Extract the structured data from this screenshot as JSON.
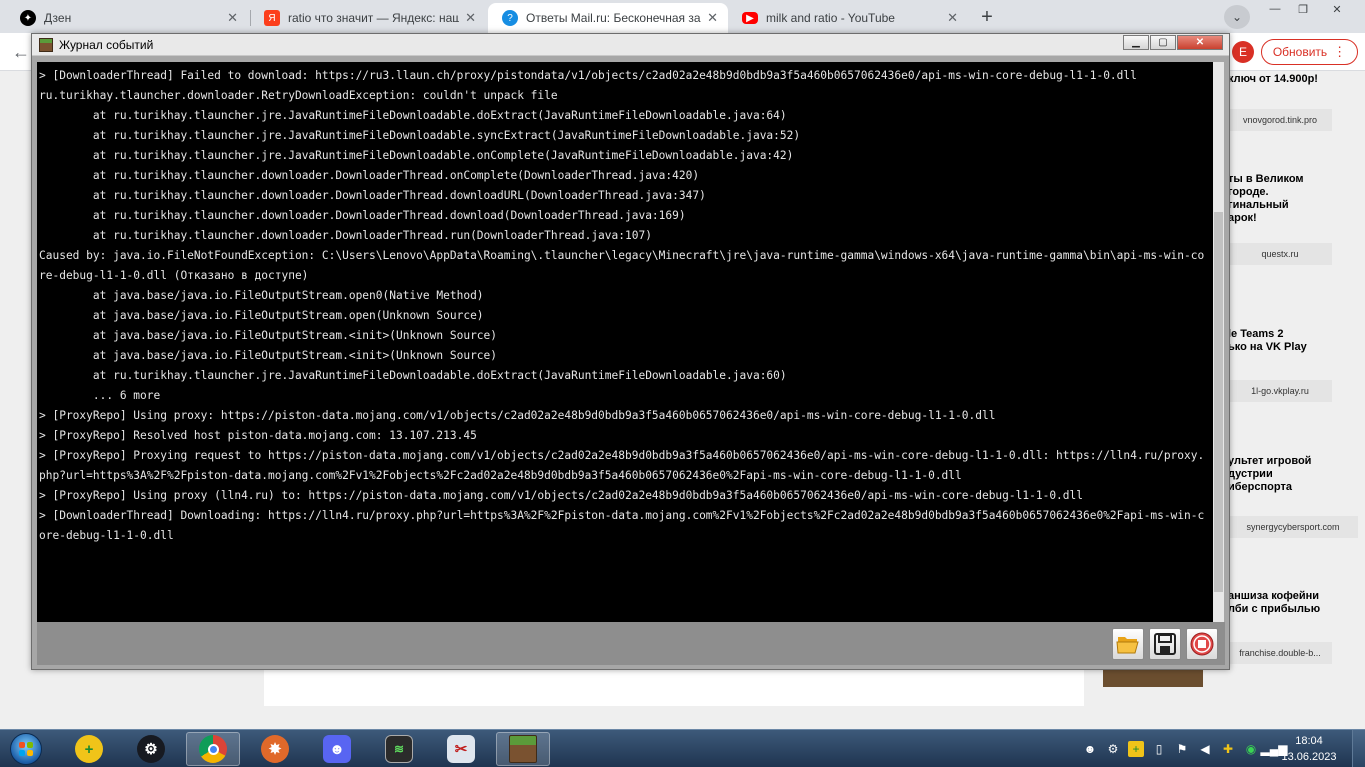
{
  "browser": {
    "tabs": [
      {
        "title": "Дзен",
        "icon": "dzen-icon",
        "color": "#000000",
        "active": false
      },
      {
        "title": "ratio что значит — Яндекс: наш",
        "icon": "yandex-icon",
        "color": "#fc3f1d",
        "active": false
      },
      {
        "title": "Ответы Mail.ru: Бесконечная за",
        "icon": "mailru-answers-icon",
        "color": "#168de2",
        "active": true
      },
      {
        "title": "milk and ratio - YouTube",
        "icon": "youtube-icon",
        "color": "#ff0000",
        "active": false
      }
    ],
    "profile_initial": "E",
    "update_label": "Обновить"
  },
  "webpage": {
    "side_ads": [
      {
        "text": "ключ от 14.900р!",
        "source": "vnovgorod.tink.pro"
      },
      {
        "text": "ты в Великом\nгороде.\nгинальный\nарок!",
        "source": "questx.ru"
      },
      {
        "text": "le Teams 2\nько на VK Play",
        "source": "1l-go.vkplay.ru"
      },
      {
        "text": "ультет игровой\nдустрии\nиберспорта",
        "source": "synergycybersport.com"
      },
      {
        "text": "аншиза кофейни\nлби с прибылью",
        "source": "franchise.double-b..."
      }
    ]
  },
  "journal": {
    "title": "Журнал событий",
    "log": [
      "> [DownloaderThread] Failed to download: https://ru3.llaun.ch/proxy/pistondata/v1/objects/c2ad02a2e48b9d0bdb9a3f5a460b0657062436e0/api-ms-win-core-debug-l1-1-0.dll",
      "ru.turikhay.tlauncher.downloader.RetryDownloadException: couldn't unpack file",
      "        at ru.turikhay.tlauncher.jre.JavaRuntimeFileDownloadable.doExtract(JavaRuntimeFileDownloadable.java:64)",
      "        at ru.turikhay.tlauncher.jre.JavaRuntimeFileDownloadable.syncExtract(JavaRuntimeFileDownloadable.java:52)",
      "        at ru.turikhay.tlauncher.jre.JavaRuntimeFileDownloadable.onComplete(JavaRuntimeFileDownloadable.java:42)",
      "        at ru.turikhay.tlauncher.downloader.DownloaderThread.onComplete(DownloaderThread.java:420)",
      "        at ru.turikhay.tlauncher.downloader.DownloaderThread.downloadURL(DownloaderThread.java:347)",
      "        at ru.turikhay.tlauncher.downloader.DownloaderThread.download(DownloaderThread.java:169)",
      "        at ru.turikhay.tlauncher.downloader.DownloaderThread.run(DownloaderThread.java:107)",
      "Caused by: java.io.FileNotFoundException: C:\\Users\\Lenovo\\AppData\\Roaming\\.tlauncher\\legacy\\Minecraft\\jre\\java-runtime-gamma\\windows-x64\\java-runtime-gamma\\bin\\api-ms-win-core-debug-l1-1-0.dll (Отказано в доступе)",
      "        at java.base/java.io.FileOutputStream.open0(Native Method)",
      "        at java.base/java.io.FileOutputStream.open(Unknown Source)",
      "        at java.base/java.io.FileOutputStream.<init>(Unknown Source)",
      "        at java.base/java.io.FileOutputStream.<init>(Unknown Source)",
      "        at ru.turikhay.tlauncher.jre.JavaRuntimeFileDownloadable.doExtract(JavaRuntimeFileDownloadable.java:60)",
      "        ... 6 more",
      "> [ProxyRepo] Using proxy: https://piston-data.mojang.com/v1/objects/c2ad02a2e48b9d0bdb9a3f5a460b0657062436e0/api-ms-win-core-debug-l1-1-0.dll",
      "> [ProxyRepo] Resolved host piston-data.mojang.com: 13.107.213.45",
      "> [ProxyRepo] Proxying request to https://piston-data.mojang.com/v1/objects/c2ad02a2e48b9d0bdb9a3f5a460b0657062436e0/api-ms-win-core-debug-l1-1-0.dll: https://lln4.ru/proxy.php?url=https%3A%2F%2Fpiston-data.mojang.com%2Fv1%2Fobjects%2Fc2ad02a2e48b9d0bdb9a3f5a460b0657062436e0%2Fapi-ms-win-core-debug-l1-1-0.dll",
      "> [ProxyRepo] Using proxy (lln4.ru) to: https://piston-data.mojang.com/v1/objects/c2ad02a2e48b9d0bdb9a3f5a460b0657062436e0/api-ms-win-core-debug-l1-1-0.dll",
      "> [DownloaderThread] Downloading: https://lln4.ru/proxy.php?url=https%3A%2F%2Fpiston-data.mojang.com%2Fv1%2Fobjects%2Fc2ad02a2e48b9d0bdb9a3f5a460b0657062436e0%2Fapi-ms-win-core-debug-l1-1-0.dll"
    ],
    "buttons": [
      "open-folder-icon",
      "save-icon",
      "stop-icon"
    ]
  },
  "taskbar": {
    "apps": [
      "add-app-icon",
      "steam-icon",
      "chrome-icon",
      "tlauncher-icon",
      "discord-icon",
      "task-manager-icon",
      "snipping-tool-icon",
      "minecraft-icon"
    ],
    "clock_time": "18:04",
    "clock_date": "13.06.2023"
  }
}
